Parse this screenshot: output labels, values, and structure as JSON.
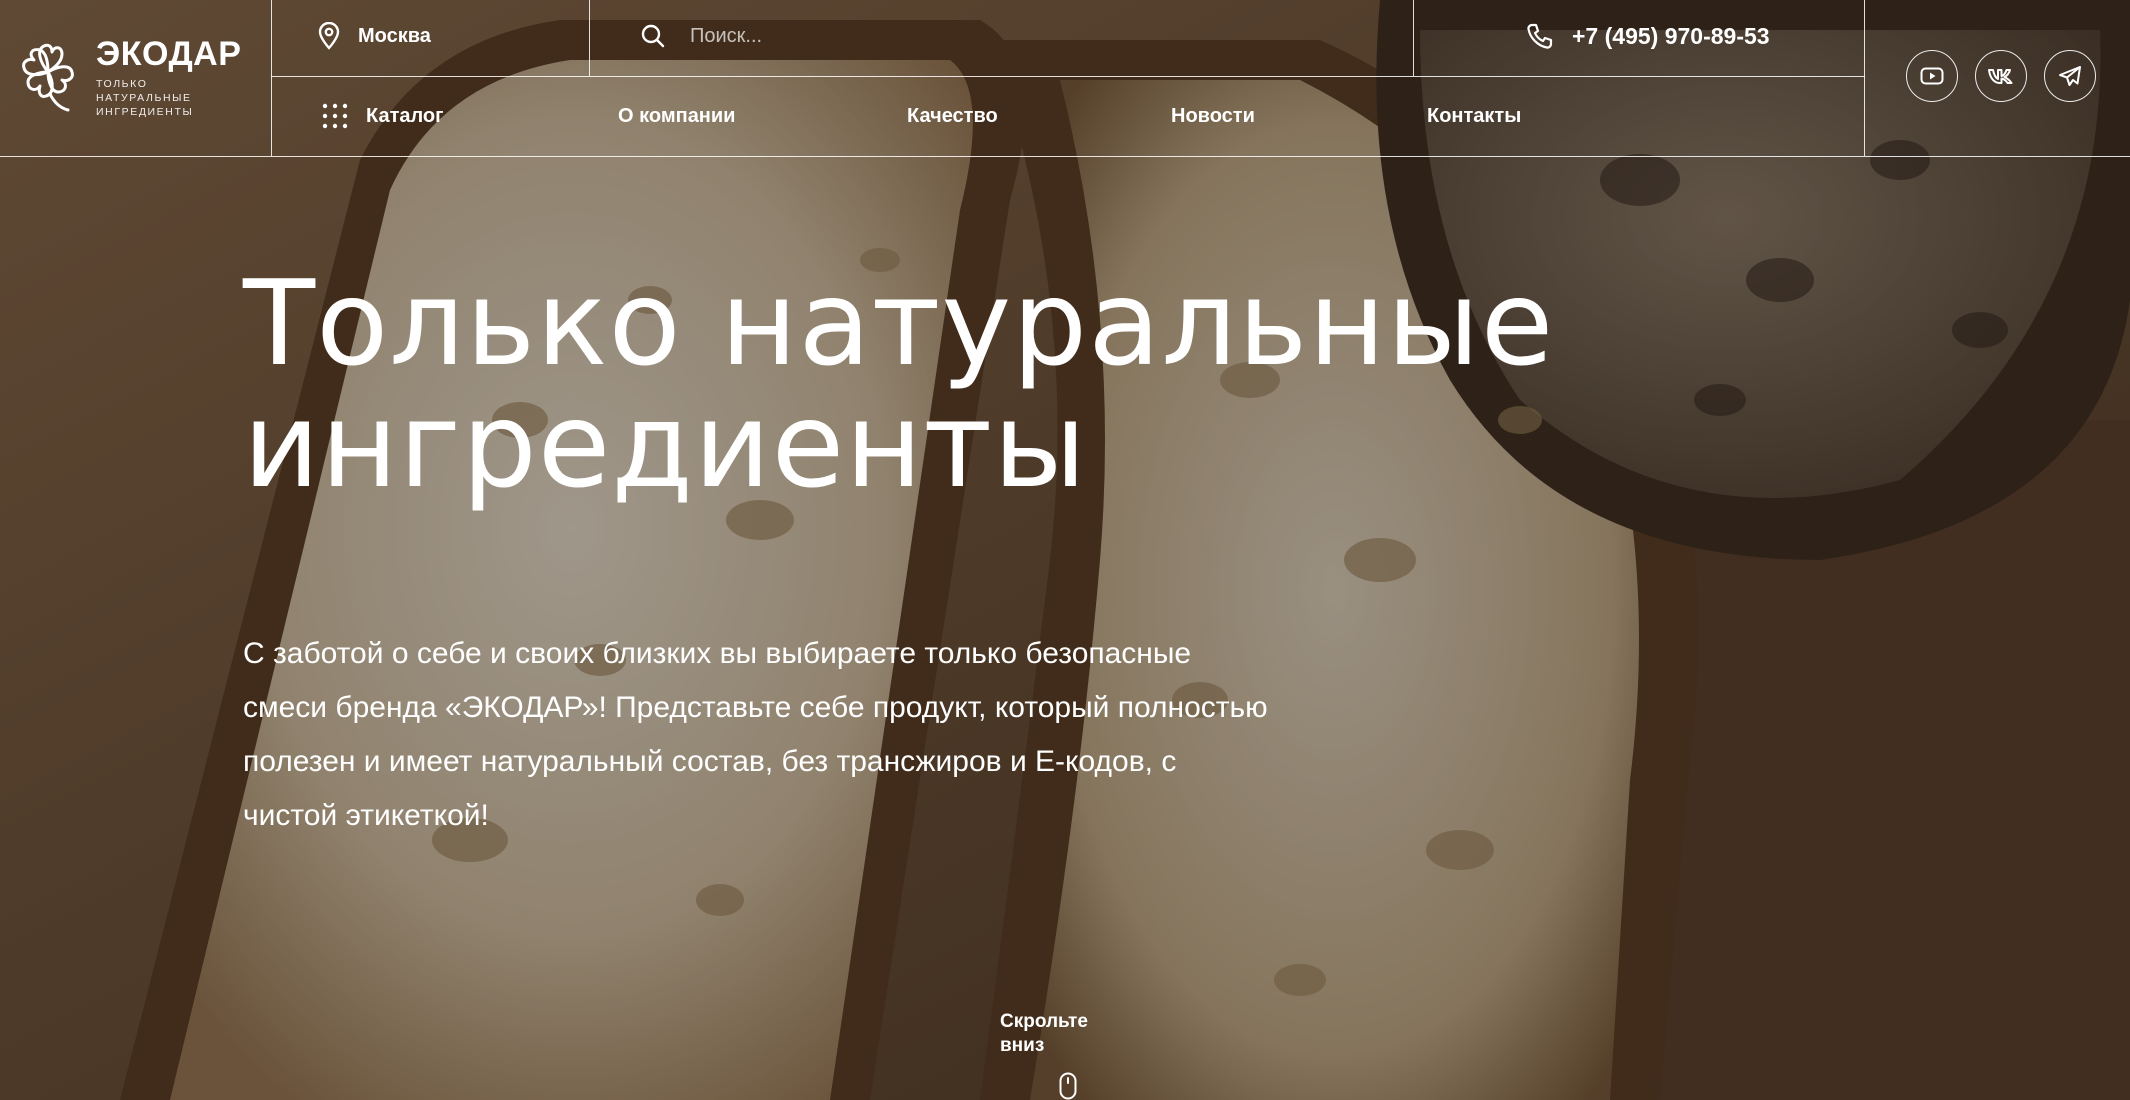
{
  "brand": {
    "name": "ЭКОДАР",
    "tagline": "ТОЛЬКО НАТУРАЛЬНЫЕ ИНГРЕДИЕНТЫ"
  },
  "header": {
    "city": "Москва",
    "search_placeholder": "Поиск...",
    "phone": "+7 (495) 970-89-53"
  },
  "nav": {
    "items": [
      {
        "label": "Каталог",
        "icon": "grid-dots-icon"
      },
      {
        "label": "О компании"
      },
      {
        "label": "Качество"
      },
      {
        "label": "Новости"
      },
      {
        "label": "Контакты"
      }
    ]
  },
  "social": {
    "items": [
      {
        "icon": "youtube-icon"
      },
      {
        "icon": "vk-icon"
      },
      {
        "icon": "telegram-icon"
      }
    ]
  },
  "hero": {
    "title_line1": "Только натуральные",
    "title_line2": "ингредиенты",
    "text": "С заботой о себе и своих близких вы выбираете только безопасные смеси бренда «ЭКОДАР»! Представьте себе продукт, который полностью полезен и имеет натуральный состав, без трансжиров и Е-кодов, с чистой этикеткой!"
  },
  "scroll_hint": {
    "label": "Скрольте вниз",
    "icon": "mouse-icon"
  },
  "colors": {
    "text": "#ffffff",
    "overlay": "#191410",
    "background": "#3a2e25"
  }
}
